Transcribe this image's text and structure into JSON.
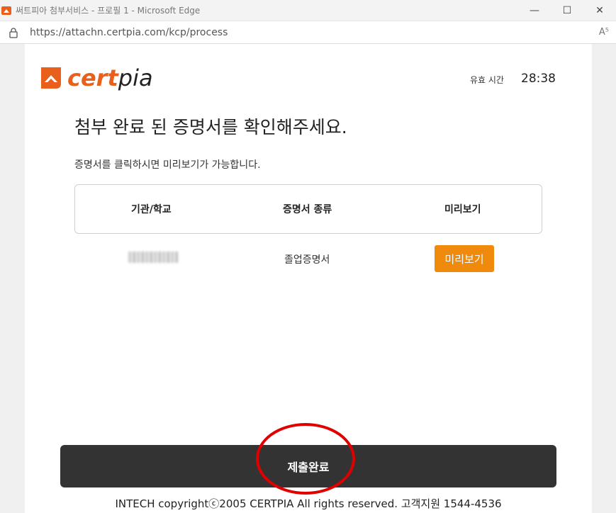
{
  "window": {
    "title": "써트피아 첨부서비스 - 프로필 1 - Microsoft Edge",
    "minimize_glyph": "—",
    "maximize_glyph": "☐",
    "close_glyph": "✕"
  },
  "address": {
    "url": "https://attachn.certpia.com/kcp/process",
    "read_aloud_glyph": "A⁵"
  },
  "logo": {
    "part1": "cert",
    "part2": "pia"
  },
  "validity": {
    "label": "유효 시간",
    "time": "28:38"
  },
  "heading": "첨부 완료 된 증명서를 확인해주세요.",
  "subtext": "증명서를 클릭하시면 미리보기가 가능합니다.",
  "table": {
    "columns": [
      "기관/학교",
      "증명서 종류",
      "미리보기"
    ],
    "rows": [
      {
        "cert_type": "졸업증명서",
        "preview_label": "미리보기"
      }
    ]
  },
  "submit_label": "제출완료",
  "footer": "INTECH copyrightⓒ2005 CERTPIA All rights reserved. 고객지원 1544-4536",
  "colors": {
    "brand_orange": "#e8601c",
    "preview_button": "#ef8a0c",
    "submit_button": "#333333",
    "highlight_circle": "#e00000"
  }
}
